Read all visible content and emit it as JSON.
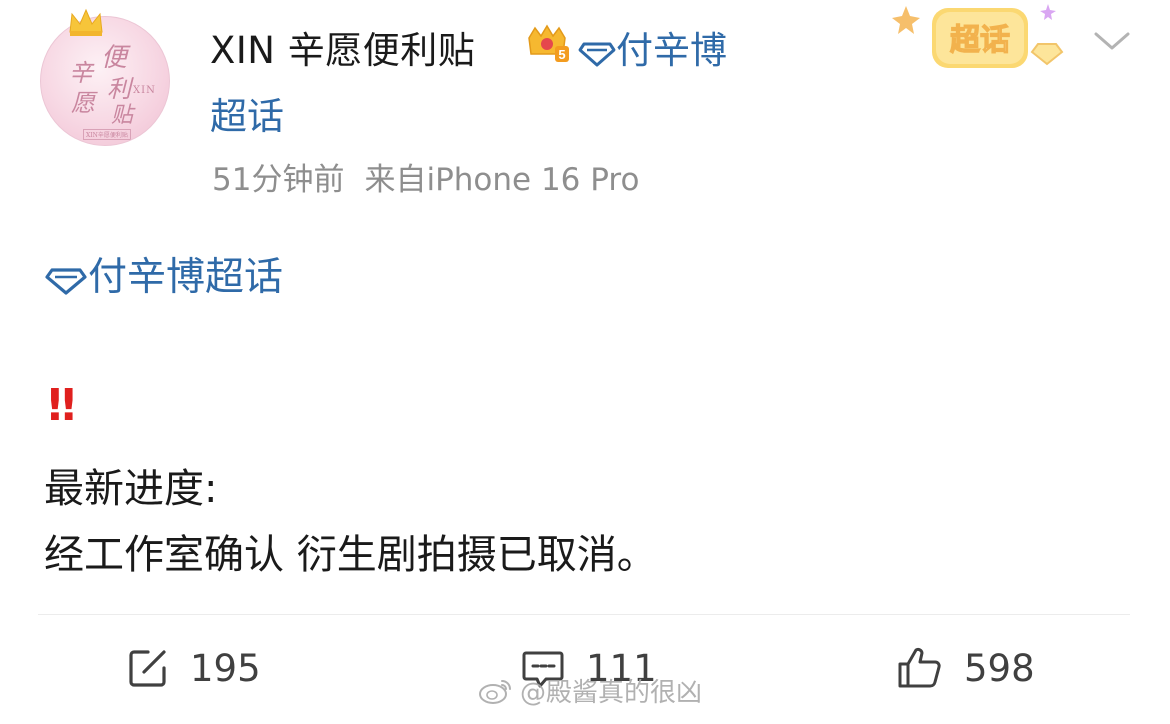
{
  "post": {
    "author": "XIN 辛愿便利贴",
    "topic_link_top_part1": "付辛博",
    "topic_link_top_part2": "超话",
    "time": "51分钟前",
    "source": "来自iPhone 16 Pro",
    "super_topic_badge": "超话",
    "body": {
      "topic_tag": "付辛博超话",
      "alert_marks": "‼",
      "line1": "最新进度:",
      "line2": "经工作室确认 衍生剧拍摄已取消。"
    }
  },
  "avatar": {
    "chars": [
      "便",
      "辛",
      "利",
      "愿",
      "贴"
    ],
    "xin_mark": "XIN",
    "bottom_label": "XIN辛愿便利贴"
  },
  "vip_level": "5",
  "actions": {
    "repost_count": "195",
    "comment_count": "111",
    "like_count": "598"
  },
  "watermark": "@殿酱真的很凶",
  "colors": {
    "link_blue": "#2f6aa8",
    "alert_red": "#e0201e",
    "meta_gray": "#8e8e8e"
  },
  "icons": [
    "crown-icon",
    "vip-badge-icon",
    "gem-icon",
    "super-topic-badge-icon",
    "chevron-down-icon",
    "repost-icon",
    "comment-icon",
    "like-icon",
    "weibo-logo-icon"
  ]
}
